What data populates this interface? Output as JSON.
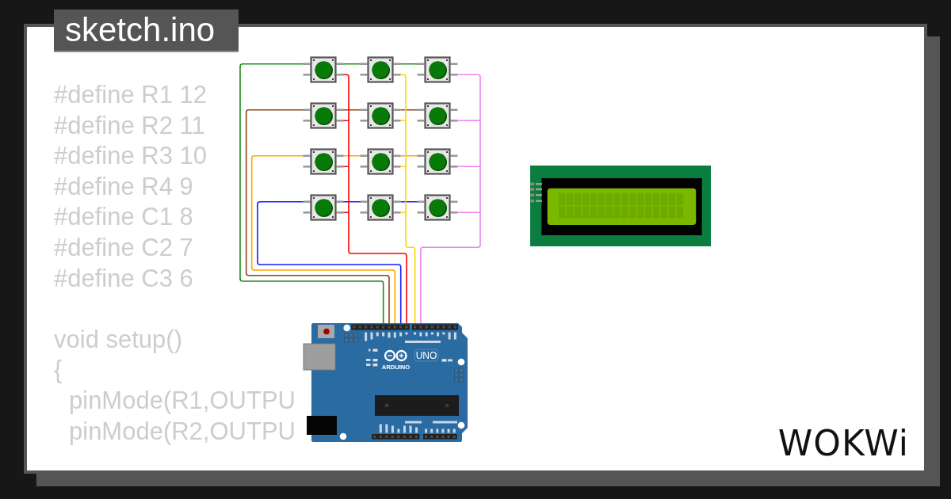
{
  "file_tab": {
    "title": "sketch.ino"
  },
  "code_blocks": [
    {
      "lines": [
        {
          "text": "#define R1 12"
        },
        {
          "text": "#define R2 11"
        },
        {
          "text": "#define R3 10"
        },
        {
          "text": "#define R4 9"
        },
        {
          "text": "#define C1 8"
        },
        {
          "text": "#define C2 7"
        },
        {
          "text": "#define C3 6"
        }
      ]
    },
    {
      "lines": [
        {
          "text": "void setup()"
        },
        {
          "text": "{",
          "children": [
            {
              "text": "pinMode(R1,OUTPU"
            },
            {
              "text": "pinMode(R2,OUTPU"
            }
          ]
        }
      ]
    }
  ],
  "circuit": {
    "wires": [
      {
        "color": "#1e8c1e"
      },
      {
        "color": "#8b4513"
      },
      {
        "color": "#ffa500"
      },
      {
        "color": "#1a1aff"
      },
      {
        "color": "#ff0000"
      },
      {
        "color": "#ffd700"
      },
      {
        "color": "#ee82ee"
      }
    ],
    "board": {
      "brand": "ARDUINO",
      "model": "UNO"
    }
  },
  "logo": {
    "text": "WOKWi"
  }
}
